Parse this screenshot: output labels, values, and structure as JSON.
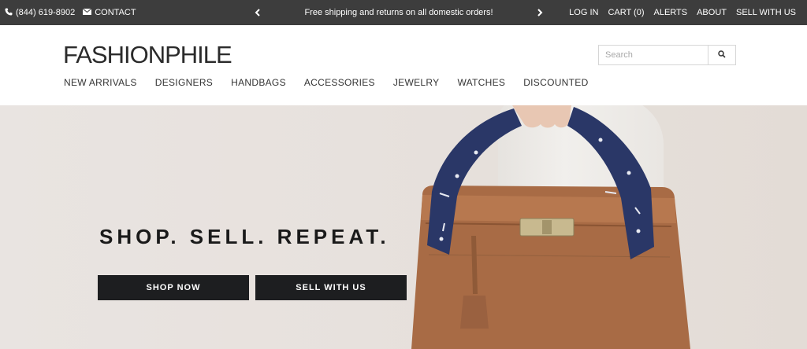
{
  "topbar": {
    "phone": "(844) 619-8902",
    "contact": "CONTACT",
    "promo": "Free shipping and returns on all domestic orders!",
    "links": [
      "LOG IN",
      "CART (0)",
      "ALERTS",
      "ABOUT",
      "SELL WITH US"
    ]
  },
  "header": {
    "logo": "FASHIONPHILE",
    "search_placeholder": "Search",
    "nav": [
      "NEW ARRIVALS",
      "DESIGNERS",
      "HANDBAGS",
      "ACCESSORIES",
      "JEWELRY",
      "WATCHES",
      "DISCOUNTED"
    ]
  },
  "hero": {
    "title": "SHOP. SELL. REPEAT.",
    "shop_button": "SHOP NOW",
    "sell_button": "SELL WITH US"
  },
  "colors": {
    "topbar_bg": "#3d3d3d",
    "button_bg": "#1d1e20",
    "bag_leather": "#a86b45"
  }
}
